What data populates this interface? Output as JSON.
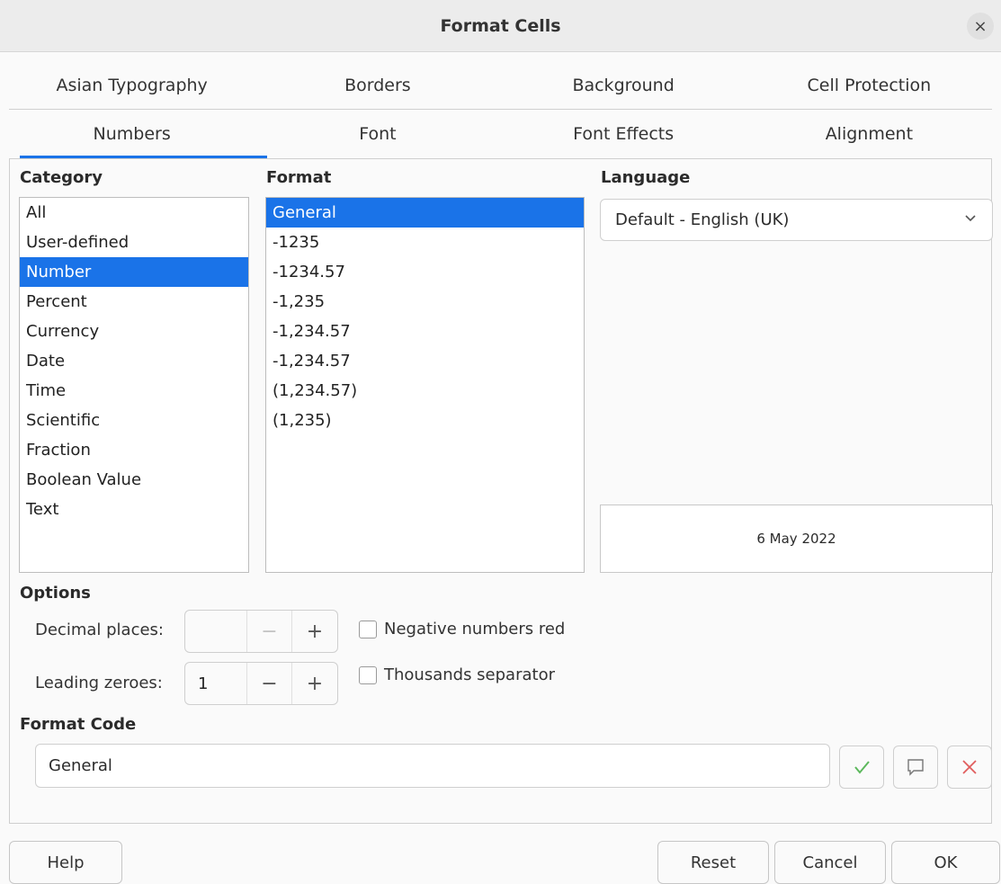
{
  "window": {
    "title": "Format Cells"
  },
  "tabs_row1": [
    "Asian Typography",
    "Borders",
    "Background",
    "Cell Protection"
  ],
  "tabs_row2": [
    "Numbers",
    "Font",
    "Font Effects",
    "Alignment"
  ],
  "active_tab": "Numbers",
  "category": {
    "label": "Category",
    "items": [
      "All",
      "User-defined",
      "Number",
      "Percent",
      "Currency",
      "Date",
      "Time",
      "Scientific",
      "Fraction",
      "Boolean Value",
      "Text"
    ],
    "selected": "Number"
  },
  "format": {
    "label": "Format",
    "items": [
      "General",
      "-1235",
      "-1234.57",
      "-1,235",
      "-1,234.57",
      "-1,234.57",
      "(1,234.57)",
      "(1,235)"
    ],
    "selected": "General"
  },
  "language": {
    "label": "Language",
    "value": "Default - English (UK)"
  },
  "preview": {
    "text": "6 May 2022"
  },
  "options": {
    "label": "Options",
    "decimal_places_label": "Decimal places:",
    "decimal_places_value": "",
    "leading_zeroes_label": "Leading zeroes:",
    "leading_zeroes_value": "1",
    "negative_red_label": "Negative numbers red",
    "thousands_sep_label": "Thousands separator",
    "minus": "−",
    "plus": "+"
  },
  "format_code": {
    "label": "Format Code",
    "value": "General"
  },
  "buttons": {
    "help": "Help",
    "reset": "Reset",
    "cancel": "Cancel",
    "ok": "OK",
    "close": "×"
  },
  "colors": {
    "accent": "#1a73e8",
    "check_green": "#5cb85c",
    "delete_red": "#e05c5c"
  }
}
